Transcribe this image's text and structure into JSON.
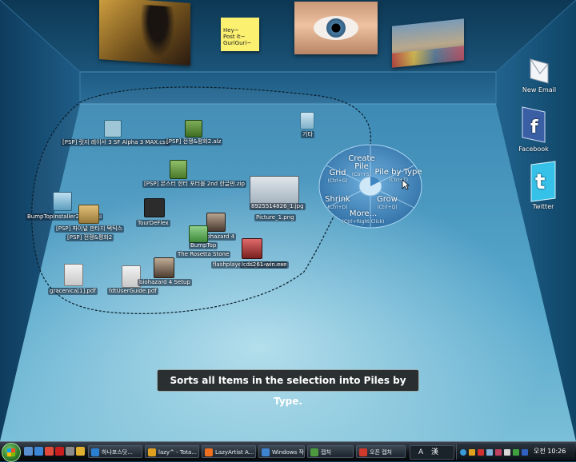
{
  "walls": {
    "postit_text": "Hey~\nPost It~\nGuriGuri~"
  },
  "desktop_items": [
    {
      "id": "psp-cso",
      "label": "[PSP] 릿지 레이서 3 SF Alpha 3 MAX.cso"
    },
    {
      "id": "psp-alz",
      "label": "[PSP] 전쟁&평화2.alz"
    },
    {
      "id": "misc-top",
      "label": "기타"
    },
    {
      "id": "psp-zip",
      "label": "[PSP] 몬스터 헌터 포터블 2nd 한글판.zip"
    },
    {
      "id": "bumptop-msi",
      "label": "BumpTopInstaller2738.msi"
    },
    {
      "id": "tourdeflex",
      "label": "TourDeFlex"
    },
    {
      "id": "psp-a",
      "label": "[PSP] 파이널 판타지 택틱스"
    },
    {
      "id": "psp-b",
      "label": "[PSP] 전쟁&평화2"
    },
    {
      "id": "jpg-8925",
      "label": "8925514826_1.jpg"
    },
    {
      "id": "picture1",
      "label": "Picture_1.png"
    },
    {
      "id": "biohazard4",
      "label": "biohazard 4"
    },
    {
      "id": "bumptop",
      "label": "BumpTop"
    },
    {
      "id": "rosetta",
      "label": "The Rosetta Stone"
    },
    {
      "id": "flashplayer",
      "label": "flashplayer_10_plugin.exe"
    },
    {
      "id": "lcds",
      "label": "lcds261-win.exe"
    },
    {
      "id": "gracenica",
      "label": "gracenica[1].pdf"
    },
    {
      "id": "fdtuserguide",
      "label": "fdtUserGuide.pdf"
    },
    {
      "id": "bio4setup",
      "label": "biohazard 4 Setup"
    }
  ],
  "pie_menu": {
    "create_pile": {
      "label": "Create Pile",
      "shortcut": "(Ctrl+S)"
    },
    "grid": {
      "label": "Grid",
      "shortcut": "(Ctrl+G)"
    },
    "pile_by_type": {
      "label": "Pile by Type",
      "shortcut": "(Ctrl+T)"
    },
    "shrink": {
      "label": "Shrink",
      "shortcut": "(Ctrl+D)"
    },
    "grow": {
      "label": "Grow",
      "shortcut": "(Ctrl+Q)"
    },
    "more": {
      "label": "More...",
      "shortcut": "(Ctrl+Right-Click)"
    }
  },
  "tooltip": "Sorts all Items in the selection into Piles by Type.",
  "social": {
    "email": "New Email",
    "facebook": "Facebook",
    "twitter": "Twitter"
  },
  "taskbar": {
    "buttons": [
      {
        "label": "하나포스닷...",
        "color": "#2a7fd3"
      },
      {
        "label": "lazy^ - Tota...",
        "color": "#e0a020"
      },
      {
        "label": "LazyArtist A...",
        "color": "#f07020"
      },
      {
        "label": "Windows 작...",
        "color": "#3d83d0"
      },
      {
        "label": "캡처",
        "color": "#4c9a3d"
      },
      {
        "label": "오픈 캡처",
        "color": "#d03a2a"
      }
    ],
    "lang": "A",
    "ime": "漢",
    "clock": "오전 10:26"
  }
}
